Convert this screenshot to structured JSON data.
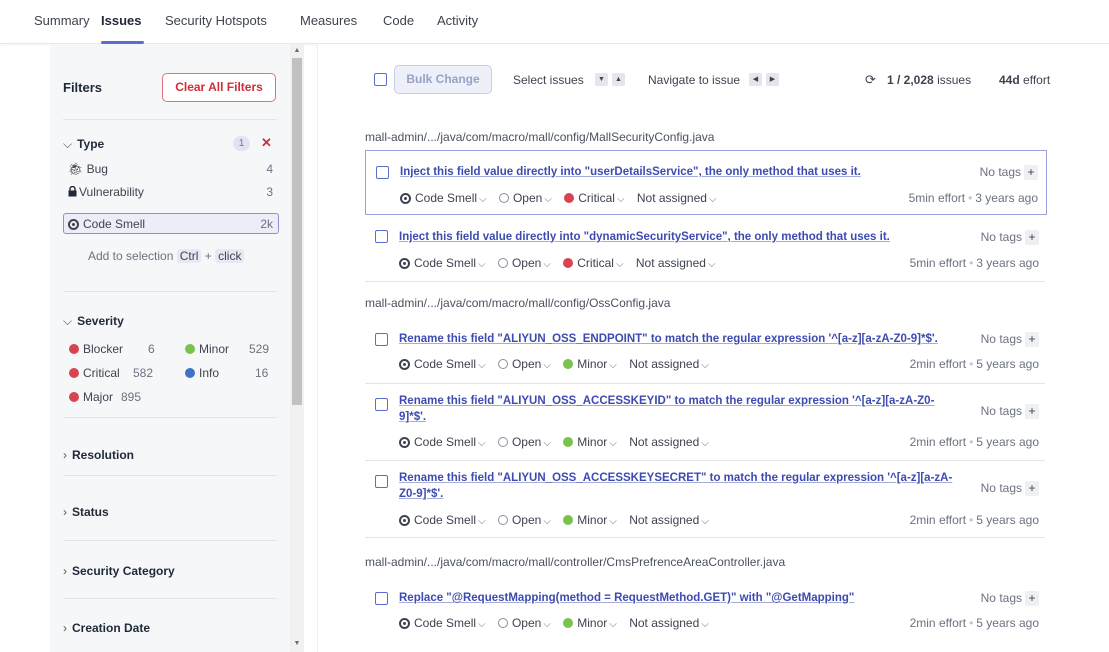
{
  "nav": {
    "tabs": [
      {
        "label": "Summary"
      },
      {
        "label": "Issues"
      },
      {
        "label": "Security Hotspots"
      },
      {
        "label": "Measures"
      },
      {
        "label": "Code"
      },
      {
        "label": "Activity"
      }
    ],
    "active_tab": "Issues",
    "accent_color": "#5d6cd0"
  },
  "sidebar": {
    "title": "Filters",
    "clear_all": "Clear All Filters",
    "type": {
      "title": "Type",
      "badge": "1",
      "items": [
        {
          "label": "Bug",
          "count": "4",
          "icon": "bug-icon"
        },
        {
          "label": "Vulnerability",
          "count": "3",
          "icon": "lock-icon"
        },
        {
          "label": "Code Smell",
          "count": "2k",
          "icon": "code-smell-icon",
          "selected": true
        }
      ],
      "add_selection_text": "Add to selection",
      "shortcut_key": "Ctrl",
      "shortcut_plus": "+",
      "shortcut_action": "click"
    },
    "severity": {
      "title": "Severity",
      "items": [
        {
          "label": "Blocker",
          "count": "6"
        },
        {
          "label": "Minor",
          "count": "529"
        },
        {
          "label": "Critical",
          "count": "582"
        },
        {
          "label": "Info",
          "count": "16"
        },
        {
          "label": "Major",
          "count": "895"
        }
      ]
    },
    "collapsed": [
      {
        "label": "Resolution"
      },
      {
        "label": "Status"
      },
      {
        "label": "Security Category"
      },
      {
        "label": "Creation Date"
      }
    ]
  },
  "toolbar": {
    "bulk_change": "Bulk Change",
    "select_issues": "Select issues",
    "navigate_to_issue": "Navigate to issue",
    "issue_count": "1 / 2,028",
    "issues_label": "issues",
    "effort_total": "44d",
    "effort_label": "effort"
  },
  "issues": {
    "groups": [
      {
        "path": "mall-admin/.../java/com/macro/mall/config/MallSecurityConfig.java",
        "items": [
          {
            "title": "Inject this field value directly into \"userDetailsService\", the only method that uses it.",
            "type": "Code Smell",
            "status": "Open",
            "severity": "Critical",
            "assignee": "Not assigned",
            "tags": "No tags",
            "effort": "5min effort",
            "age": "3 years ago"
          },
          {
            "title": "Inject this field value directly into \"dynamicSecurityService\", the only method that uses it.",
            "type": "Code Smell",
            "status": "Open",
            "severity": "Critical",
            "assignee": "Not assigned",
            "tags": "No tags",
            "effort": "5min effort",
            "age": "3 years ago"
          }
        ]
      },
      {
        "path": "mall-admin/.../java/com/macro/mall/config/OssConfig.java",
        "items": [
          {
            "title": "Rename this field \"ALIYUN_OSS_ENDPOINT\" to match the regular expression '^[a-z][a-zA-Z0-9]*$'.",
            "type": "Code Smell",
            "status": "Open",
            "severity": "Minor",
            "assignee": "Not assigned",
            "tags": "No tags",
            "effort": "2min effort",
            "age": "5 years ago"
          },
          {
            "title": "Rename this field \"ALIYUN_OSS_ACCESSKEYID\" to match the regular expression '^[a-z][a-zA-Z0-9]*$'.",
            "type": "Code Smell",
            "status": "Open",
            "severity": "Minor",
            "assignee": "Not assigned",
            "tags": "No tags",
            "effort": "2min effort",
            "age": "5 years ago"
          },
          {
            "title": "Rename this field \"ALIYUN_OSS_ACCESSKEYSECRET\" to match the regular expression '^[a-z][a-zA-Z0-9]*$'.",
            "type": "Code Smell",
            "status": "Open",
            "severity": "Minor",
            "assignee": "Not assigned",
            "tags": "No tags",
            "effort": "2min effort",
            "age": "5 years ago"
          }
        ]
      },
      {
        "path": "mall-admin/.../java/com/macro/mall/controller/CmsPrefrenceAreaController.java",
        "items": [
          {
            "title": "Replace \"@RequestMapping(method = RequestMethod.GET)\" with \"@GetMapping\"",
            "type": "Code Smell",
            "status": "Open",
            "severity": "Minor",
            "assignee": "Not assigned",
            "tags": "No tags",
            "effort": "2min effort",
            "age": "5 years ago"
          }
        ]
      }
    ]
  }
}
